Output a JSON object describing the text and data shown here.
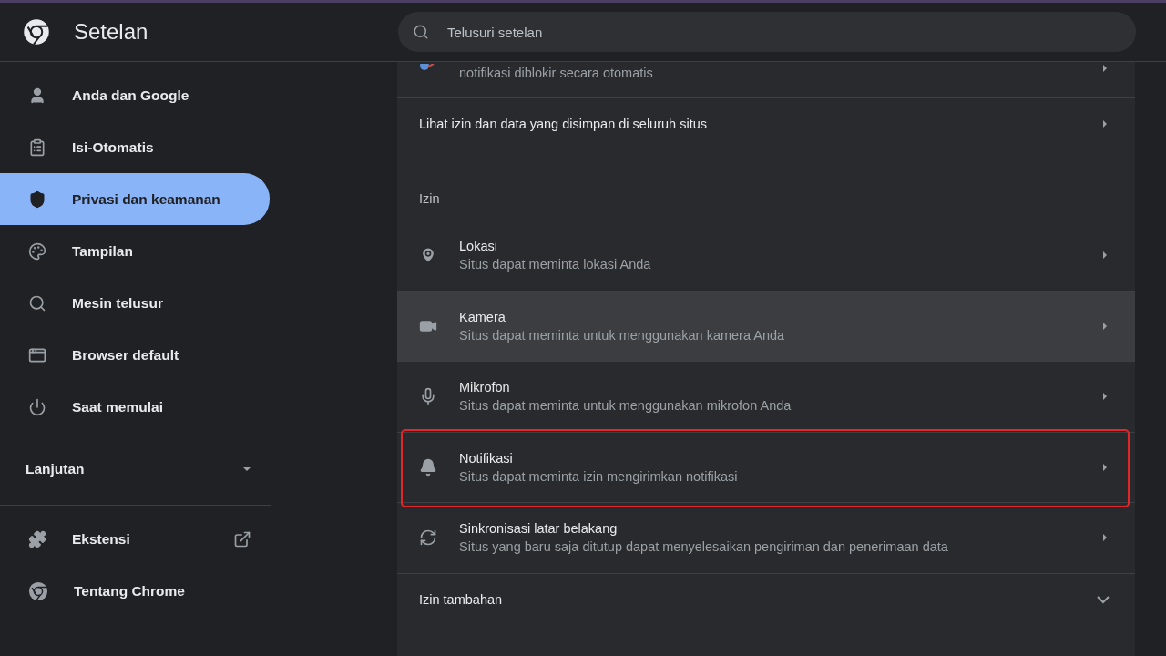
{
  "header": {
    "title": "Setelan",
    "search": {
      "placeholder": "Telusuri setelan"
    }
  },
  "sidebar": {
    "items": [
      {
        "kind": "person",
        "label": "Anda dan Google",
        "selected": false
      },
      {
        "kind": "clipboard",
        "label": "Isi-Otomatis",
        "selected": false
      },
      {
        "kind": "shield",
        "label": "Privasi dan keamanan",
        "selected": true
      },
      {
        "kind": "palette",
        "label": "Tampilan",
        "selected": false
      },
      {
        "kind": "search",
        "label": "Mesin telusur",
        "selected": false
      },
      {
        "kind": "browser",
        "label": "Browser default",
        "selected": false
      },
      {
        "kind": "power",
        "label": "Saat memulai",
        "selected": false
      }
    ],
    "advanced": {
      "label": "Lanjutan",
      "expanded": false
    },
    "footer_items": [
      {
        "kind": "puzzle",
        "label": "Ekstensi",
        "external": true
      },
      {
        "kind": "chrome",
        "label": "Tentang Chrome",
        "external": false
      }
    ]
  },
  "content": {
    "partial_row": {
      "subtitle": "notifikasi diblokir secara otomatis"
    },
    "site_data_row": {
      "title": "Lihat izin dan data yang disimpan di seluruh situs"
    },
    "permissions": {
      "heading": "Izin",
      "rows": [
        {
          "kind": "location",
          "title": "Lokasi",
          "subtitle": "Situs dapat meminta lokasi Anda",
          "hovered": false,
          "highlighted": false
        },
        {
          "kind": "camera",
          "title": "Kamera",
          "subtitle": "Situs dapat meminta untuk menggunakan kamera Anda",
          "hovered": true,
          "highlighted": false
        },
        {
          "kind": "microphone",
          "title": "Mikrofon",
          "subtitle": "Situs dapat meminta untuk menggunakan mikrofon Anda",
          "hovered": false,
          "highlighted": false
        },
        {
          "kind": "notifications",
          "title": "Notifikasi",
          "subtitle": "Situs dapat meminta izin mengirimkan notifikasi",
          "hovered": false,
          "highlighted": true
        },
        {
          "kind": "sync",
          "title": "Sinkronisasi latar belakang",
          "subtitle": "Situs yang baru saja ditutup dapat menyelesaikan pengiriman dan penerimaan data",
          "hovered": false,
          "highlighted": false
        }
      ]
    },
    "additional": {
      "label": "Izin tambahan",
      "expanded": false
    }
  }
}
